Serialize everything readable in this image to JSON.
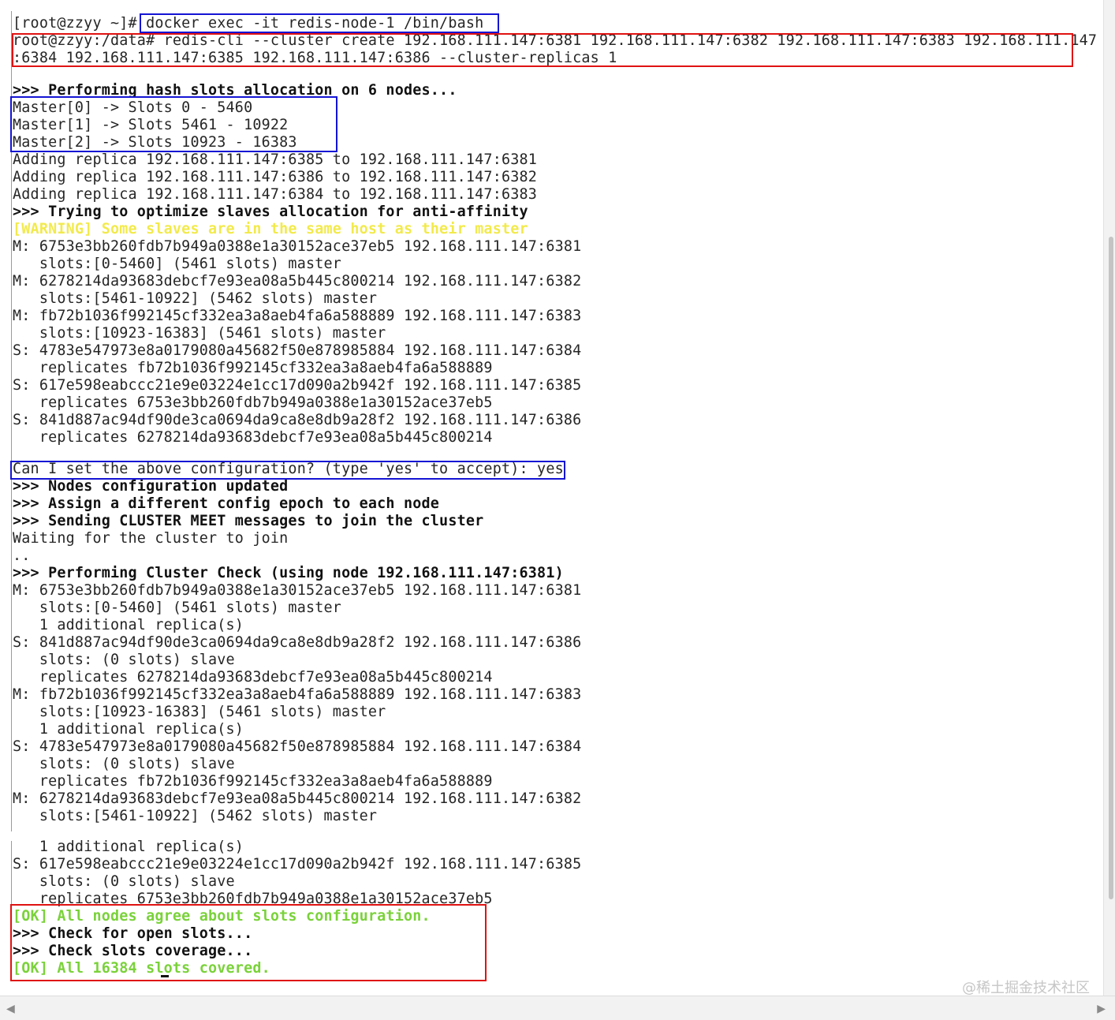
{
  "terminal": {
    "lines": [
      {
        "text": "[root@zzyy ~]# docker exec -it redis-node-1 /bin/bash",
        "style": "n"
      },
      {
        "text": "root@zzyy:/data# redis-cli --cluster create 192.168.111.147:6381 192.168.111.147:6382 192.168.111.147:6383 192.168.111.147",
        "style": "n"
      },
      {
        "text": ":6384 192.168.111.147:6385 192.168.111.147:6386 --cluster-replicas 1",
        "style": "n"
      },
      {
        "text": ">>> Performing hash slots allocation on 6 nodes...",
        "style": "b"
      },
      {
        "text": "Master[0] -> Slots 0 - 5460",
        "style": "n"
      },
      {
        "text": "Master[1] -> Slots 5461 - 10922",
        "style": "n"
      },
      {
        "text": "Master[2] -> Slots 10923 - 16383",
        "style": "n"
      },
      {
        "text": "Adding replica 192.168.111.147:6385 to 192.168.111.147:6381",
        "style": "n"
      },
      {
        "text": "Adding replica 192.168.111.147:6386 to 192.168.111.147:6382",
        "style": "n"
      },
      {
        "text": "Adding replica 192.168.111.147:6384 to 192.168.111.147:6383",
        "style": "n"
      },
      {
        "text": ">>> Trying to optimize slaves allocation for anti-affinity",
        "style": "b"
      },
      {
        "text": "[WARNING] Some slaves are in the same host as their master",
        "style": "warn"
      },
      {
        "text": "M: 6753e3bb260fdb7b949a0388e1a30152ace37eb5 192.168.111.147:6381",
        "style": "n"
      },
      {
        "text": "   slots:[0-5460] (5461 slots) master",
        "style": "n"
      },
      {
        "text": "M: 6278214da93683debcf7e93ea08a5b445c800214 192.168.111.147:6382",
        "style": "n"
      },
      {
        "text": "   slots:[5461-10922] (5462 slots) master",
        "style": "n"
      },
      {
        "text": "M: fb72b1036f992145cf332ea3a8aeb4fa6a588889 192.168.111.147:6383",
        "style": "n"
      },
      {
        "text": "   slots:[10923-16383] (5461 slots) master",
        "style": "n"
      },
      {
        "text": "S: 4783e547973e8a0179080a45682f50e878985884 192.168.111.147:6384",
        "style": "n"
      },
      {
        "text": "   replicates fb72b1036f992145cf332ea3a8aeb4fa6a588889",
        "style": "n"
      },
      {
        "text": "S: 617e598eabccc21e9e03224e1cc17d090a2b942f 192.168.111.147:6385",
        "style": "n"
      },
      {
        "text": "   replicates 6753e3bb260fdb7b949a0388e1a30152ace37eb5",
        "style": "n"
      },
      {
        "text": "S: 841d887ac94df90de3ca0694da9ca8e8db9a28f2 192.168.111.147:6386",
        "style": "n"
      },
      {
        "text": "   replicates 6278214da93683debcf7e93ea08a5b445c800214",
        "style": "n"
      },
      {
        "text": "Can I set the above configuration? (type 'yes' to accept): yes",
        "style": "n"
      },
      {
        "text": ">>> Nodes configuration updated",
        "style": "b"
      },
      {
        "text": ">>> Assign a different config epoch to each node",
        "style": "b"
      },
      {
        "text": ">>> Sending CLUSTER MEET messages to join the cluster",
        "style": "b"
      },
      {
        "text": "Waiting for the cluster to join",
        "style": "n"
      },
      {
        "text": "..",
        "style": "n"
      },
      {
        "text": ">>> Performing Cluster Check (using node 192.168.111.147:6381)",
        "style": "b"
      },
      {
        "text": "M: 6753e3bb260fdb7b949a0388e1a30152ace37eb5 192.168.111.147:6381",
        "style": "n"
      },
      {
        "text": "   slots:[0-5460] (5461 slots) master",
        "style": "n"
      },
      {
        "text": "   1 additional replica(s)",
        "style": "n"
      },
      {
        "text": "S: 841d887ac94df90de3ca0694da9ca8e8db9a28f2 192.168.111.147:6386",
        "style": "n"
      },
      {
        "text": "   slots: (0 slots) slave",
        "style": "n"
      },
      {
        "text": "   replicates 6278214da93683debcf7e93ea08a5b445c800214",
        "style": "n"
      },
      {
        "text": "M: fb72b1036f992145cf332ea3a8aeb4fa6a588889 192.168.111.147:6383",
        "style": "n"
      },
      {
        "text": "   slots:[10923-16383] (5461 slots) master",
        "style": "n"
      },
      {
        "text": "   1 additional replica(s)",
        "style": "n"
      },
      {
        "text": "S: 4783e547973e8a0179080a45682f50e878985884 192.168.111.147:6384",
        "style": "n"
      },
      {
        "text": "   slots: (0 slots) slave",
        "style": "n"
      },
      {
        "text": "   replicates fb72b1036f992145cf332ea3a8aeb4fa6a588889",
        "style": "n"
      },
      {
        "text": "M: 6278214da93683debcf7e93ea08a5b445c800214 192.168.111.147:6382",
        "style": "n"
      },
      {
        "text": "   slots:[5461-10922] (5462 slots) master",
        "style": "n"
      },
      {
        "text": "   1 additional replica(s)",
        "style": "n"
      },
      {
        "text": "S: 617e598eabccc21e9e03224e1cc17d090a2b942f 192.168.111.147:6385",
        "style": "n"
      },
      {
        "text": "   slots: (0 slots) slave",
        "style": "n"
      },
      {
        "text": "   replicates 6753e3bb260fdb7b949a0388e1a30152ace37eb5",
        "style": "n"
      },
      {
        "text": "[OK] All nodes agree about slots configuration.",
        "style": "ok"
      },
      {
        "text": ">>> Check for open slots...",
        "style": "b"
      },
      {
        "text": ">>> Check slots coverage...",
        "style": "b"
      },
      {
        "text": "[OK] All 16384 slots covered.",
        "style": "ok"
      }
    ]
  },
  "colors": {
    "highlight_blue": "#1414d4",
    "highlight_red": "#e01212",
    "warning": "#f2ea4c",
    "ok": "#7ad23a"
  },
  "watermark": "@稀土掘金技术社区",
  "scrollbar": {
    "left_arrow_icon": "◀",
    "right_arrow_icon": "▶"
  }
}
